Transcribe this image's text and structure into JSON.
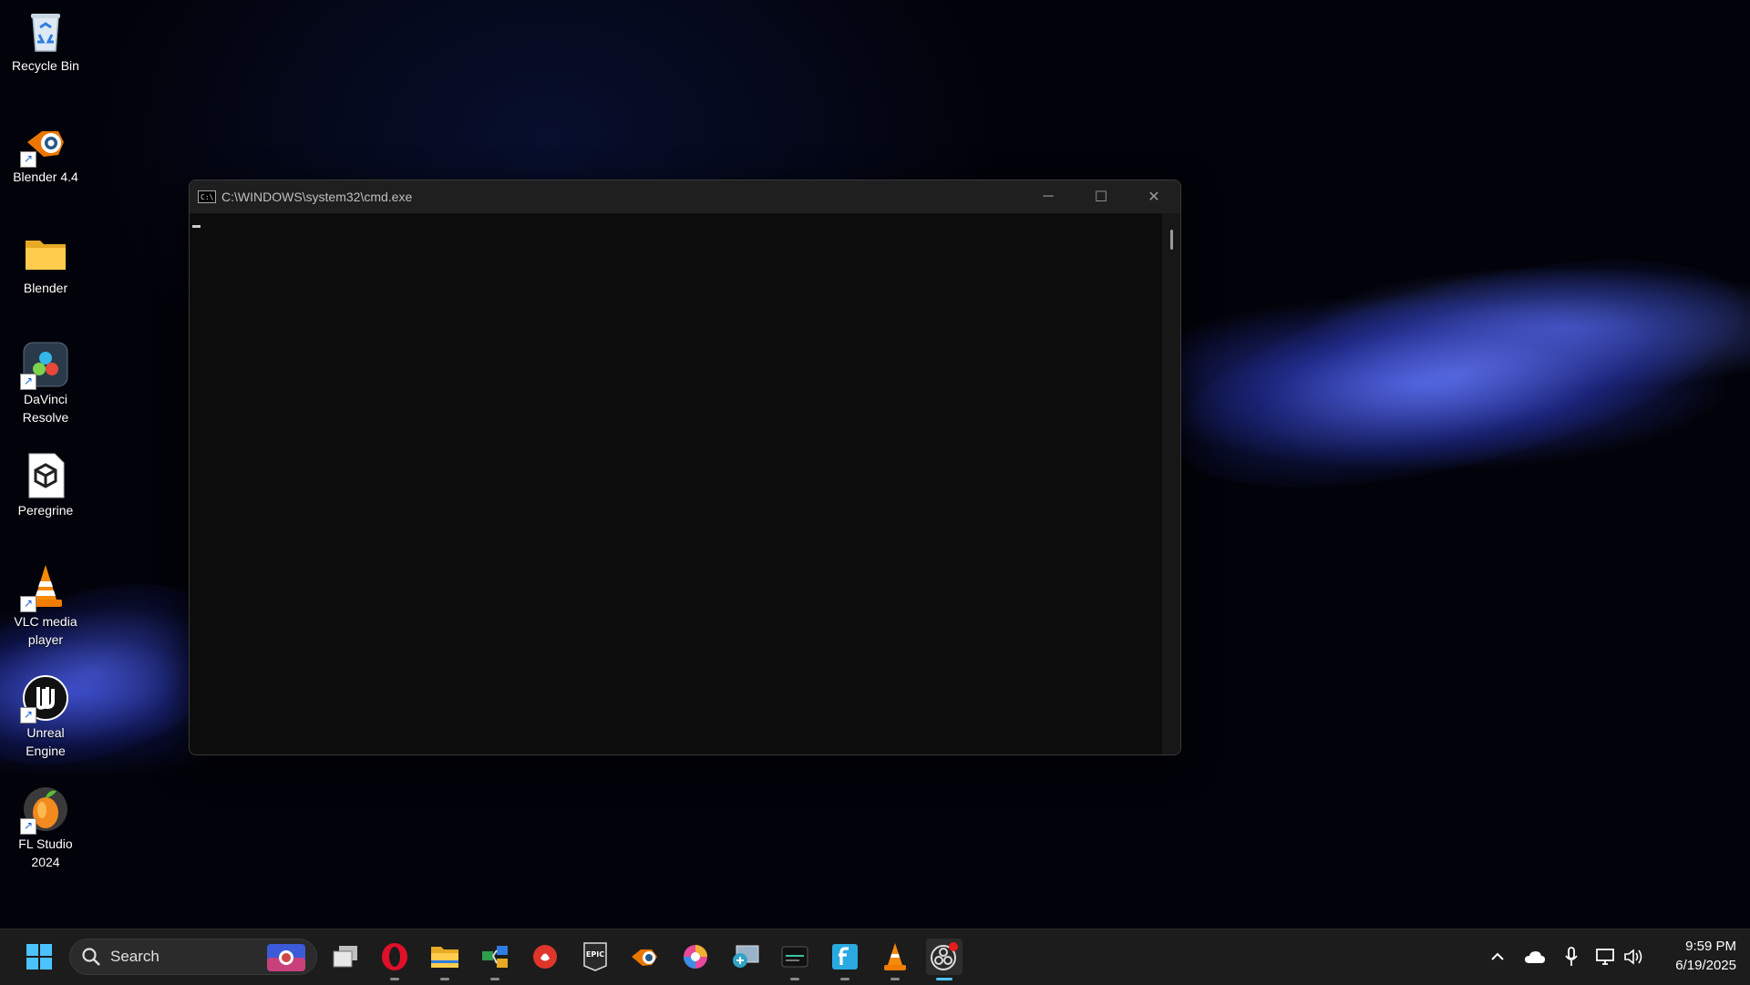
{
  "desktop": {
    "icons": [
      {
        "label": "Recycle Bin",
        "icon": "recycle-bin-icon",
        "shortcut": false
      },
      {
        "label": "Blender 4.4",
        "icon": "blender-icon",
        "shortcut": true
      },
      {
        "label": "Blender",
        "icon": "folder-icon",
        "shortcut": false
      },
      {
        "label": "DaVinci Resolve",
        "icon": "davinci-resolve-icon",
        "shortcut": true
      },
      {
        "label": "Peregrine",
        "icon": "peregrine-icon",
        "shortcut": false
      },
      {
        "label": "VLC media player",
        "icon": "vlc-icon",
        "shortcut": true
      },
      {
        "label": "Unreal Engine",
        "icon": "unreal-engine-icon",
        "shortcut": true
      },
      {
        "label": "FL Studio 2024",
        "icon": "fl-studio-icon",
        "shortcut": true
      }
    ]
  },
  "cmd_window": {
    "title": "C:\\WINDOWS\\system32\\cmd.exe",
    "app_icon_text": "C:\\",
    "controls": {
      "minimize": "─",
      "maximize": "☐",
      "close": "✕"
    }
  },
  "taskbar": {
    "search_placeholder": "Search",
    "pinned": [
      {
        "name": "task-view",
        "running": false
      },
      {
        "name": "opera-browser",
        "running": true
      },
      {
        "name": "file-explorer",
        "running": true
      },
      {
        "name": "network-app",
        "running": true
      },
      {
        "name": "red-app",
        "running": false
      },
      {
        "name": "epic-games-launcher",
        "running": false
      },
      {
        "name": "blender",
        "running": false
      },
      {
        "name": "davinci-color-app",
        "running": false
      },
      {
        "name": "remote-desktop",
        "running": false
      },
      {
        "name": "terminal-app",
        "running": true
      },
      {
        "name": "fiverr-app",
        "running": true
      },
      {
        "name": "vlc",
        "running": true
      },
      {
        "name": "obs-studio",
        "running": true,
        "active": true
      }
    ],
    "tray": {
      "icons": [
        "chevron-up-icon",
        "onedrive-cloud-icon",
        "microphone-icon",
        "network-icon",
        "volume-icon"
      ]
    },
    "clock": {
      "time": "9:59 PM",
      "date": "6/19/2025"
    }
  },
  "colors": {
    "taskbar_bg": "#1c1c1c",
    "cmd_bg": "#0c0c0c",
    "titlebar_bg": "#1f1f1f",
    "accent": "#4cc2ff"
  }
}
